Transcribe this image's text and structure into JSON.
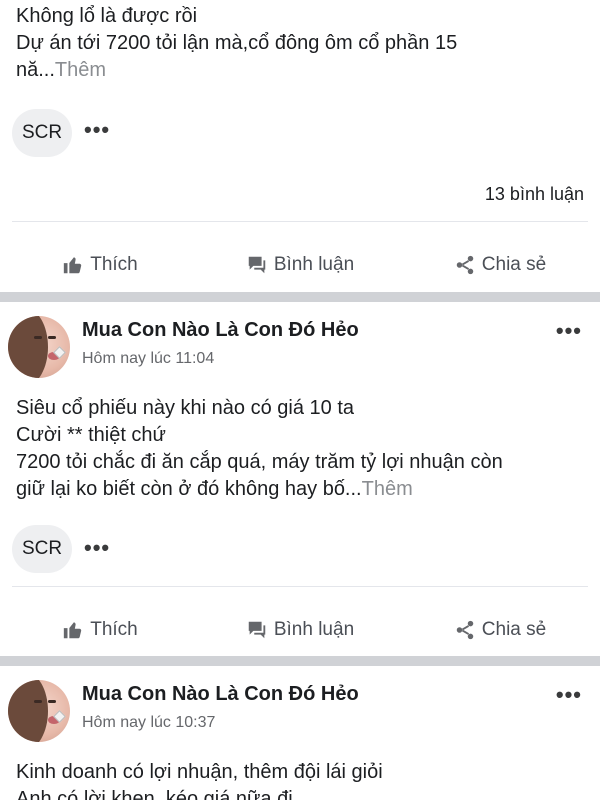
{
  "posts": [
    {
      "lines": [
        "Không lổ là được rồi",
        "Dự án tới 7200 tỏi lận mà,cổ đông ôm cổ phần 15"
      ],
      "last_line": "nă...",
      "more_label": "Thêm",
      "chip_label": "SCR",
      "chip_more": "•••",
      "comment_count": "13 bình luận"
    },
    {
      "author": "Mua Con Nào Là Con Đó Hẻo",
      "timestamp": "Hôm nay lúc 11:04",
      "menu": "•••",
      "lines": [
        "Siêu cổ phiếu này khi nào có giá 10 ta",
        "Cười ** thiệt chứ",
        "7200 tỏi chắc đi ăn cắp quá, máy trăm tỷ lợi nhuận còn"
      ],
      "last_line": "giữ lại ko biết còn ở đó không hay bố...",
      "more_label": "Thêm",
      "chip_label": "SCR",
      "chip_more": "•••"
    },
    {
      "author": "Mua Con Nào Là Con Đó Hẻo",
      "timestamp": "Hôm nay lúc 10:37",
      "menu": "•••",
      "lines": [
        "Kinh doanh có lợi nhuận, thêm đội lái giỏi",
        "Anh có lời khen, kéo giá nữa đi"
      ]
    }
  ],
  "actions": {
    "like": "Thích",
    "comment": "Bình luận",
    "share": "Chia sẻ"
  },
  "icons": {
    "like": "thumbs-up-icon",
    "comment": "comment-bubble-icon",
    "share": "share-icon",
    "more": "more-dots-icon"
  }
}
